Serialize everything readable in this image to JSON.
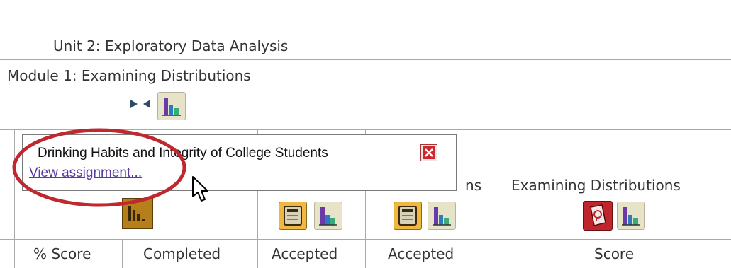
{
  "unit_title": "Unit 2: Exploratory Data Analysis",
  "module_title": "Module 1: Examining Distributions",
  "tooltip": {
    "title": "Drinking Habits and Integrity of College Students",
    "link": "View assignment..."
  },
  "columns": {
    "partial_label": "ns",
    "examining_distributions": "Examining Distributions"
  },
  "row_headers": [
    "% Score",
    "Completed",
    "Accepted",
    "Accepted",
    "Score"
  ],
  "colors": {
    "annotation_ellipse": "#c0282e",
    "link": "#5a3aa0",
    "close_icon": "#d0262c",
    "doc_icon": "#f0b840"
  }
}
